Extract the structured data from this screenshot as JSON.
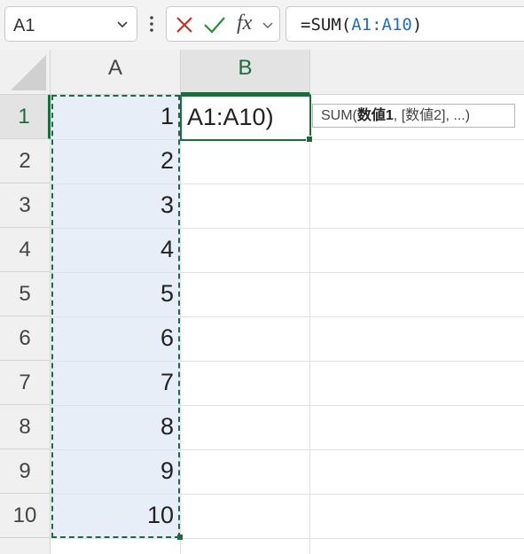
{
  "name_box": {
    "value": "A1"
  },
  "formula_bar": {
    "fx_label": "fx",
    "prefix": "=SUM(",
    "reference": "A1:A10",
    "suffix": ")"
  },
  "tooltip": {
    "func": "SUM(",
    "arg_bold": "数値1",
    "rest": ", [数値2], ...)"
  },
  "columns": [
    "A",
    "B"
  ],
  "rows": [
    "1",
    "2",
    "3",
    "4",
    "5",
    "6",
    "7",
    "8",
    "9",
    "10"
  ],
  "column_a_values": [
    "1",
    "2",
    "3",
    "4",
    "5",
    "6",
    "7",
    "8",
    "9",
    "10"
  ],
  "active_cell": {
    "display": "A1:A10)"
  },
  "colors": {
    "accent": "#1e6b3e",
    "reference": "#1f6fc5",
    "selection_fill": "#e8eef8"
  }
}
